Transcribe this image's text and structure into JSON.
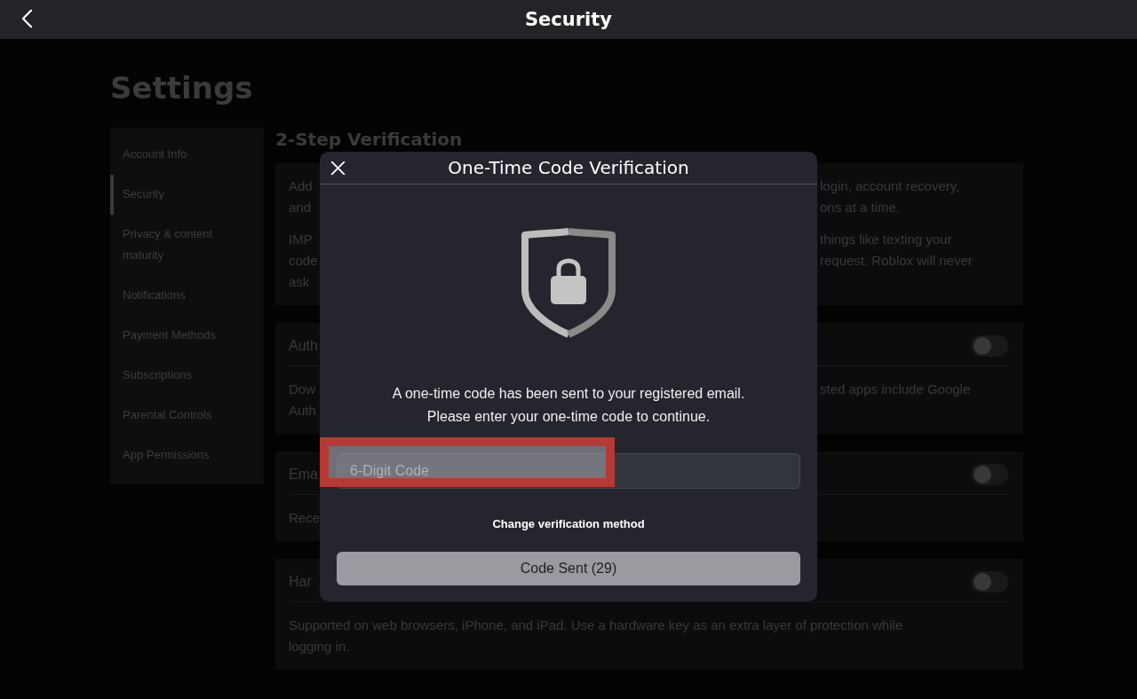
{
  "header": {
    "title": "Security"
  },
  "page_title": "Settings",
  "sidebar": {
    "items": [
      {
        "label": "Account Info",
        "selected": false
      },
      {
        "label": "Security",
        "selected": true
      },
      {
        "label": "Privacy & content maturity",
        "selected": false
      },
      {
        "label": "Notifications",
        "selected": false
      },
      {
        "label": "Payment Methods",
        "selected": false
      },
      {
        "label": "Subscriptions",
        "selected": false
      },
      {
        "label": "Parental Controls",
        "selected": false
      },
      {
        "label": "App Permissions",
        "selected": false
      }
    ]
  },
  "section_title": "2-Step Verification",
  "intro_card": {
    "paragraphs": [
      {
        "lines": [
          {
            "left": "Add",
            "right": "login, account recovery,"
          },
          {
            "left": "and",
            "right": "ons at a time."
          }
        ]
      },
      {
        "lines": [
          {
            "left": "IMP",
            "right": "things like texting your"
          },
          {
            "left": "code",
            "right": "request. Roblox will never"
          },
          {
            "left": "ask"
          }
        ]
      }
    ]
  },
  "methods": [
    {
      "title": "Auth",
      "on": false,
      "description_lines": [
        {
          "left": "Dow",
          "right": "sted apps include Google"
        },
        {
          "left": "Auth"
        }
      ]
    },
    {
      "title": "Ema",
      "on": false,
      "description_lines": [
        {
          "left": "Rece"
        }
      ]
    },
    {
      "title": "Har",
      "on": false,
      "description_lines": [
        {
          "left": "Supported on web browsers, iPhone, and iPad. Use a hardware key as an extra layer of protection while"
        },
        {
          "left": "logging in."
        }
      ]
    }
  ],
  "dialog": {
    "title": "One-Time Code Verification",
    "message_lines": [
      "A one-time code has been sent to your registered email.",
      "Please enter your one-time code to continue."
    ],
    "code_field": {
      "placeholder": "6-Digit Code",
      "highlighted": true
    },
    "link": "Change verification method",
    "button": {
      "label": "Code Sent (29)",
      "disabled": true
    }
  }
}
